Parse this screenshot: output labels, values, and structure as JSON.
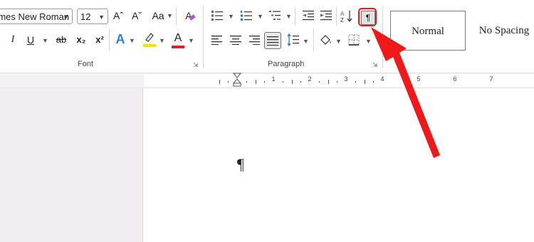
{
  "ribbon": {
    "font_group": {
      "label": "Font",
      "font_name": "Times New Roman",
      "font_size": "12",
      "buttons": {
        "grow": "Aˆ",
        "shrink": "Aˇ",
        "change_case": "Aa",
        "clear": "A",
        "italic": "I",
        "underline": "U",
        "strike": "ab",
        "subscript": "x₂",
        "superscript": "x²",
        "effects": "A",
        "highlight": "ab",
        "font_color": "A"
      },
      "highlight_color": "#f6e300",
      "font_color_bar": "#e02020"
    },
    "paragraph_group": {
      "label": "Paragraph",
      "show_hide_label": "¶"
    },
    "styles": {
      "normal": "Normal",
      "no_spacing": "No Spacing"
    }
  },
  "ruler": {
    "numbers": [
      "1",
      "2",
      "3",
      "4",
      "5",
      "6",
      "7"
    ]
  },
  "document": {
    "paragraph_mark": "¶"
  },
  "annotation": {
    "color": "#f01818",
    "target": "show-hide-button"
  }
}
